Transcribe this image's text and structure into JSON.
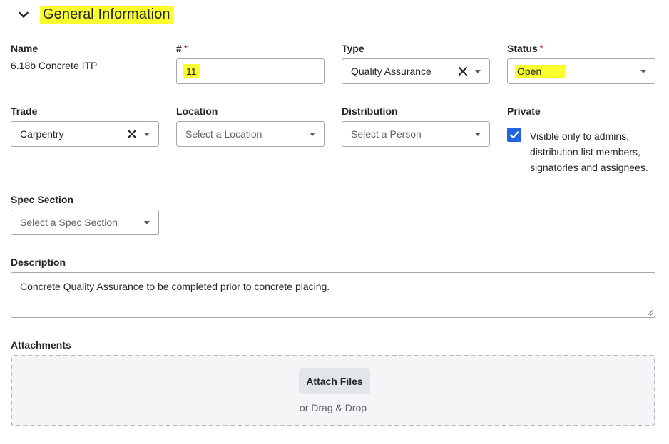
{
  "section": {
    "title": "General Information",
    "highlight_color": "#fbff2e"
  },
  "fields": {
    "name": {
      "label": "Name",
      "value": "6.18b Concrete ITP"
    },
    "number": {
      "label": "#",
      "required_mark": "*",
      "value": "11"
    },
    "type": {
      "label": "Type",
      "value": "Quality Assurance"
    },
    "status": {
      "label": "Status",
      "required_mark": "*",
      "value": "Open"
    },
    "trade": {
      "label": "Trade",
      "value": "Carpentry"
    },
    "location": {
      "label": "Location",
      "placeholder": "Select a Location"
    },
    "distribution": {
      "label": "Distribution",
      "placeholder": "Select a Person"
    },
    "private": {
      "label": "Private",
      "checked": true,
      "text": "Visible only to admins, distribution list members, signatories and assignees."
    },
    "spec_section": {
      "label": "Spec Section",
      "placeholder": "Select a Spec Section"
    },
    "description": {
      "label": "Description",
      "value": "Concrete Quality Assurance to be completed prior to concrete placing."
    },
    "attachments": {
      "label": "Attachments",
      "button": "Attach Files",
      "hint": "or Drag & Drop"
    }
  },
  "icons": {
    "section_toggle": "chevron-down-icon",
    "clear": "close-icon",
    "dropdown": "caret-down-icon",
    "check": "check-icon"
  },
  "colors": {
    "accent": "#2066df",
    "required": "#d92a2a",
    "border": "#a3a8ad"
  }
}
